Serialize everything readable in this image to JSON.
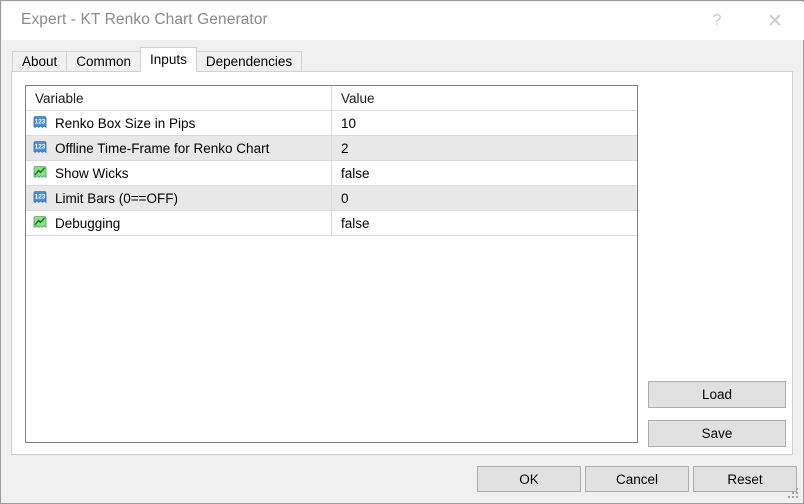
{
  "window": {
    "title": "Expert - KT Renko Chart Generator",
    "help_icon": "question-mark-icon",
    "close_icon": "close-icon"
  },
  "tabs": [
    {
      "label": "About",
      "selected": false
    },
    {
      "label": "Common",
      "selected": false
    },
    {
      "label": "Inputs",
      "selected": true
    },
    {
      "label": "Dependencies",
      "selected": false
    }
  ],
  "grid": {
    "columns": [
      "Variable",
      "Value"
    ],
    "rows": [
      {
        "icon": "integer-type-icon",
        "variable": "Renko Box Size in Pips",
        "value": "10"
      },
      {
        "icon": "integer-type-icon",
        "variable": "Offline Time-Frame for Renko Chart",
        "value": "2"
      },
      {
        "icon": "boolean-type-icon",
        "variable": "Show Wicks",
        "value": "false"
      },
      {
        "icon": "integer-type-icon",
        "variable": "Limit Bars (0==OFF)",
        "value": "0"
      },
      {
        "icon": "boolean-type-icon",
        "variable": "Debugging",
        "value": "false"
      }
    ]
  },
  "side_buttons": {
    "load": "Load",
    "save": "Save"
  },
  "footer_buttons": {
    "ok": "OK",
    "cancel": "Cancel",
    "reset": "Reset"
  },
  "colors": {
    "window_bg": "#f0f0f0",
    "panel_bg": "#ffffff",
    "button_face": "#e1e1e1",
    "button_border": "#adadad",
    "grid_border": "#808080",
    "alt_row": "#e8e8e8",
    "title_text": "#8a8a8a",
    "int_icon": "#4a90d9",
    "bool_icon": "#7ed07e"
  }
}
